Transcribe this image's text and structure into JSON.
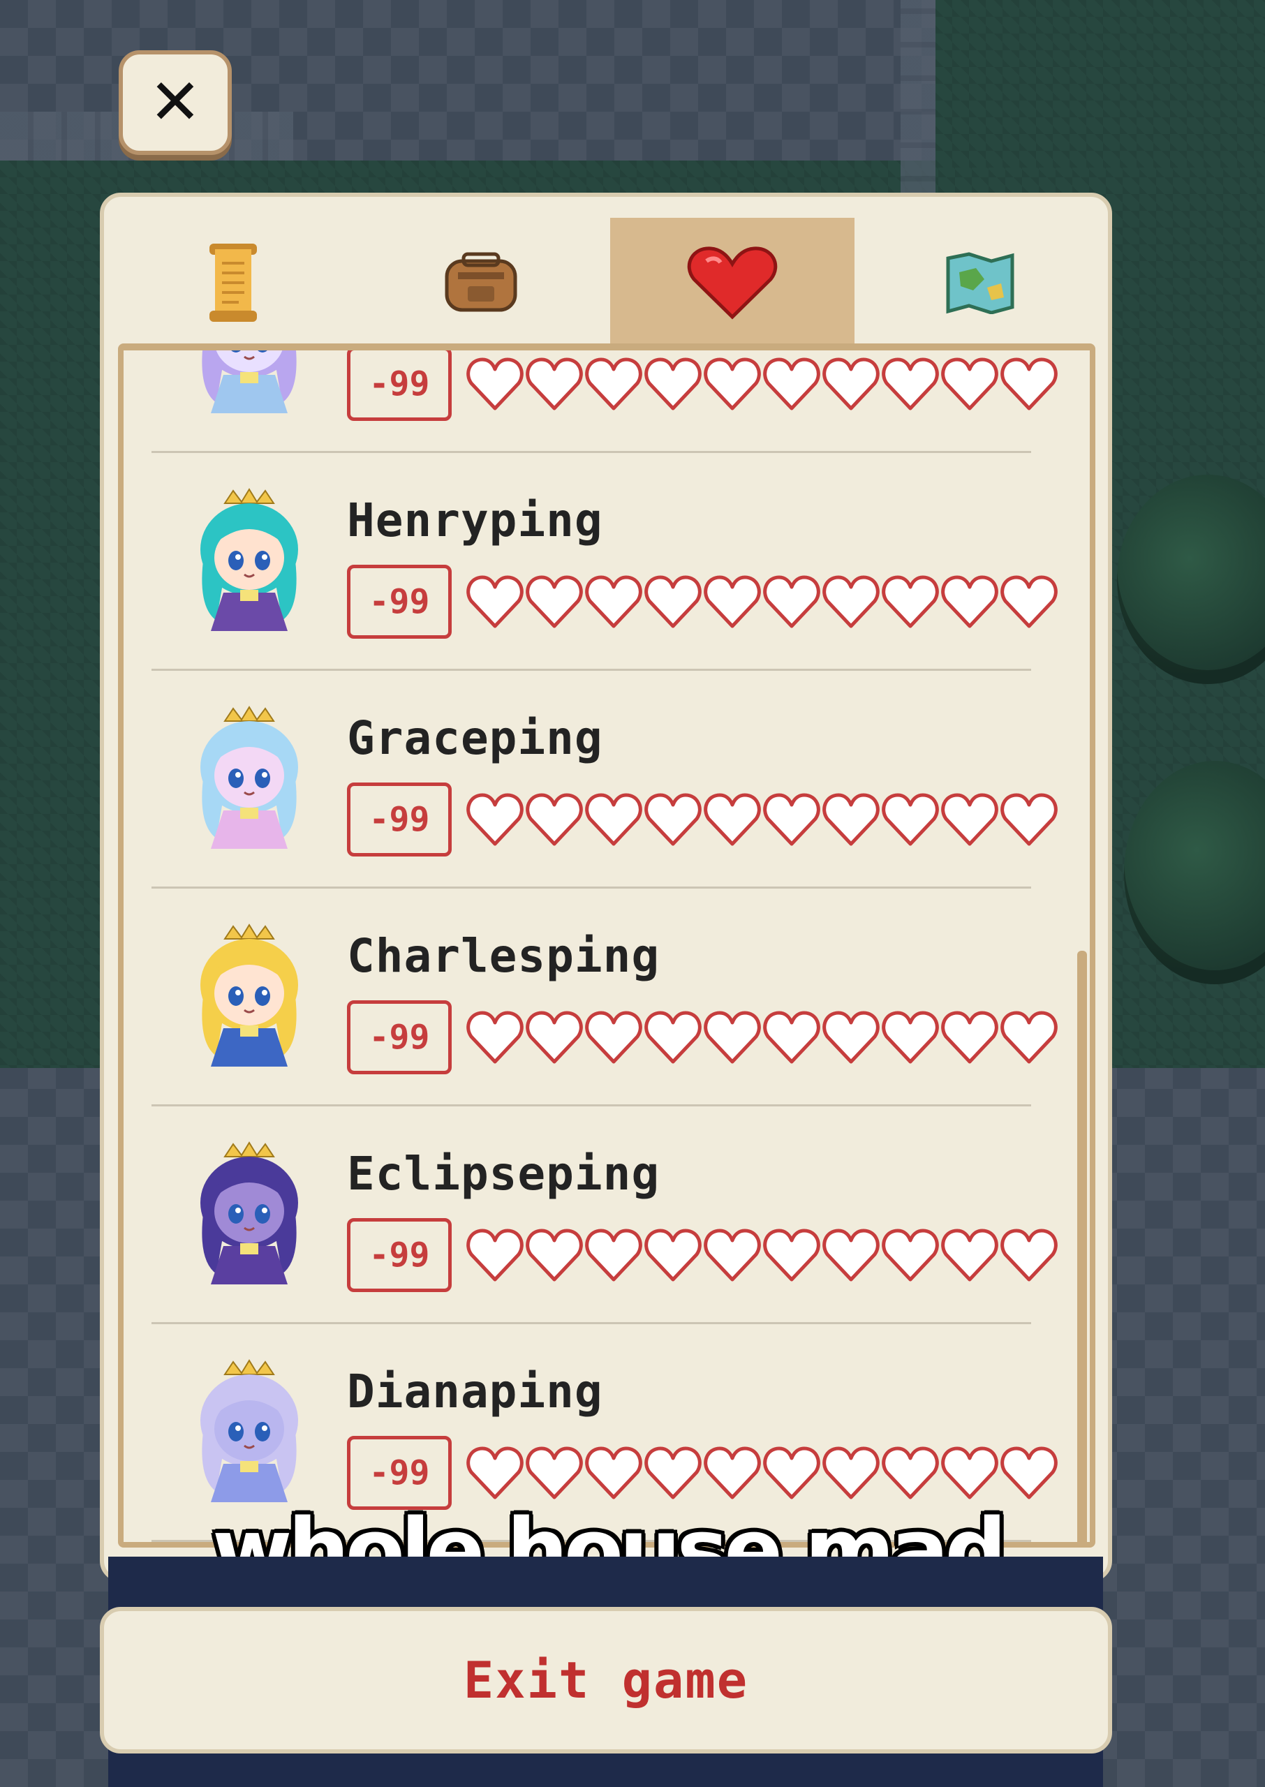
{
  "close_button": {
    "label": "✕"
  },
  "tabs": [
    {
      "name": "quests",
      "icon": "scroll-icon",
      "active": false
    },
    {
      "name": "inventory",
      "icon": "backpack-icon",
      "active": false
    },
    {
      "name": "relationships",
      "icon": "heart-icon",
      "active": true
    },
    {
      "name": "map",
      "icon": "map-icon",
      "active": false
    }
  ],
  "characters": [
    {
      "name": "",
      "score": "-99",
      "hearts_filled": 0,
      "hearts_total": 10,
      "avatar_colors": {
        "hair": "#b9a6ef",
        "skin": "#e9e0ff",
        "dress": "#9fc7ef"
      }
    },
    {
      "name": "Henryping",
      "score": "-99",
      "hearts_filled": 0,
      "hearts_total": 10,
      "avatar_colors": {
        "hair": "#2cc4c4",
        "skin": "#ffe2cf",
        "dress": "#6b4aa8"
      }
    },
    {
      "name": "Graceping",
      "score": "-99",
      "hearts_filled": 0,
      "hearts_total": 10,
      "avatar_colors": {
        "hair": "#a7d8f5",
        "skin": "#f3d8f5",
        "dress": "#e7b5ea"
      }
    },
    {
      "name": "Charlesping",
      "score": "-99",
      "hearts_filled": 0,
      "hearts_total": 10,
      "avatar_colors": {
        "hair": "#f5cf4a",
        "skin": "#ffe4d2",
        "dress": "#3d67c4"
      }
    },
    {
      "name": "Eclipseping",
      "score": "-99",
      "hearts_filled": 0,
      "hearts_total": 10,
      "avatar_colors": {
        "hair": "#4a3a9a",
        "skin": "#a08ad6",
        "dress": "#5a3fa0"
      }
    },
    {
      "name": "Dianaping",
      "score": "-99",
      "hearts_filled": 0,
      "hearts_total": 10,
      "avatar_colors": {
        "hair": "#c9c4f2",
        "skin": "#b9b6ef",
        "dress": "#8d9be8"
      }
    }
  ],
  "caption": "whole house mad",
  "exit_button": {
    "label": "Exit game"
  },
  "colors": {
    "accent_red": "#c63d3d",
    "panel_bg": "#f1ecdc",
    "tab_active": "#d7b98e"
  }
}
